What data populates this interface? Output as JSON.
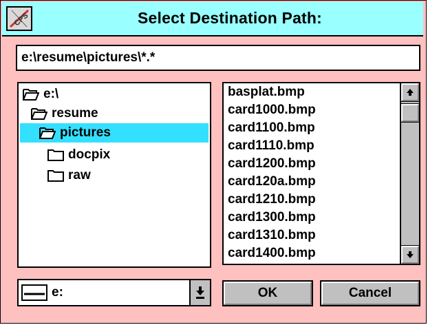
{
  "window": {
    "title": "Select Destination Path:"
  },
  "path_field": {
    "value": "e:\\resume\\pictures\\*.*"
  },
  "directories": [
    {
      "label": "e:\\",
      "icon": "open-folder-icon",
      "selected": false
    },
    {
      "label": "resume",
      "icon": "open-folder-icon",
      "selected": false
    },
    {
      "label": "pictures",
      "icon": "open-folder-icon",
      "selected": true
    },
    {
      "label": "docpix",
      "icon": "closed-folder-icon",
      "selected": false
    },
    {
      "label": "raw",
      "icon": "closed-folder-icon",
      "selected": false
    }
  ],
  "files": [
    "basplat.bmp",
    "card1000.bmp",
    "card1100.bmp",
    "card1110.bmp",
    "card1200.bmp",
    "card120a.bmp",
    "card1210.bmp",
    "card1300.bmp",
    "card1310.bmp",
    "card1400.bmp"
  ],
  "drive_select": {
    "value": "e:",
    "icon": "drive-icon"
  },
  "buttons": {
    "ok": "OK",
    "cancel": "Cancel"
  },
  "colors": {
    "dialog_bg": "#ffc0c0",
    "titlebar": "#99ffff",
    "selection": "#33e0ff"
  }
}
